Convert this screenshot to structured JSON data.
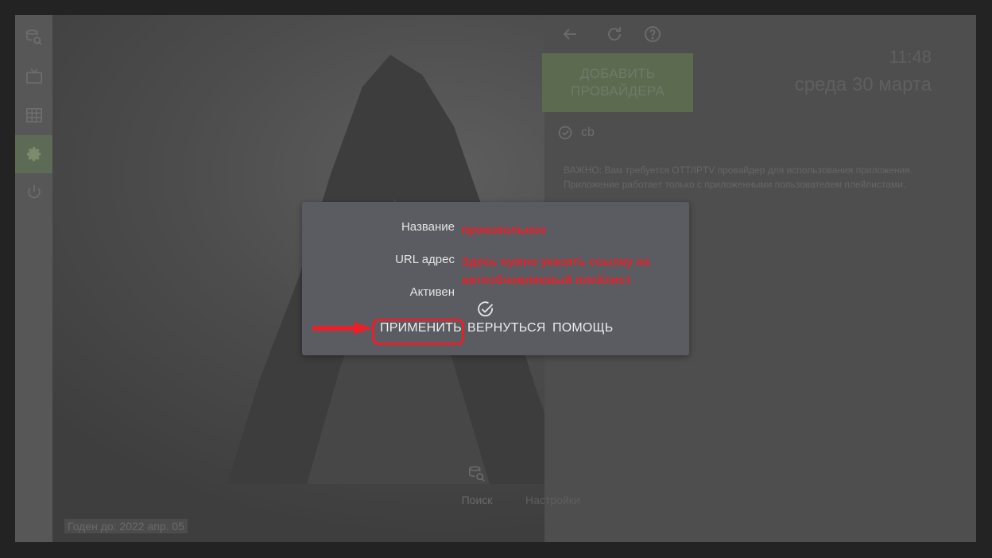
{
  "sidebar": {
    "items": [
      {
        "icon": "database-search-icon"
      },
      {
        "icon": "tv-icon"
      },
      {
        "icon": "grid-icon"
      },
      {
        "icon": "gear-icon",
        "active": true
      },
      {
        "icon": "power-icon"
      }
    ]
  },
  "right_panel": {
    "toolbar": {
      "back": "back-arrow-icon",
      "refresh": "refresh-icon",
      "help": "help-icon"
    },
    "add_provider_label": "ДОБАВИТЬ\nПРОВАЙДЕРА",
    "clock": "11:48",
    "date": "среда 30 марта",
    "provider_name": "cb",
    "notice": "ВАЖНО: Вам требуется OTT/IPTV провайдер для использования приложения. Приложение работает только с приложенными пользователем плейлистами."
  },
  "validity": "Годен до: 2022 апр. 05",
  "bottom_nav": {
    "search_label": "Поиск",
    "settings_label": "Настройки"
  },
  "dialog": {
    "name_label": "Название",
    "url_label": "URL адрес",
    "active_label": "Активен",
    "apply_label": "ПРИМЕНИТЬ",
    "back_label": "ВЕРНУТЬСЯ",
    "help_label": "ПОМОЩЬ"
  },
  "annotations": {
    "name_hint": "произвольное",
    "url_hint_line1": "Здесь нужно указать  ссылку на",
    "url_hint_line2": "автообновляемый плейлист"
  },
  "colors": {
    "annotation": "#e8202a",
    "active_accent": "#5d6a55",
    "dialog_bg": "#5b5c62",
    "background": "#232323"
  }
}
